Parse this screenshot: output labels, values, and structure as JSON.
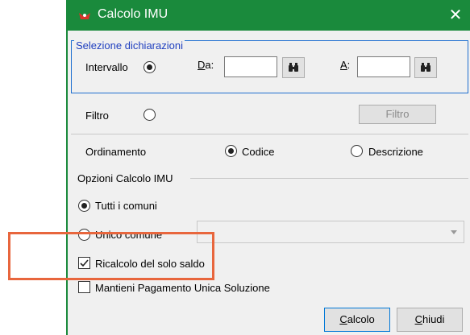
{
  "window": {
    "title": "Calcolo IMU",
    "close_glyph": "✕",
    "title_bar_color": "#1a8a3c"
  },
  "selezione": {
    "legend": "Selezione dichiarazioni",
    "intervallo_label": "Intervallo",
    "intervallo_checked": true,
    "da_label": "Da:",
    "da_value": "",
    "a_label": "A:",
    "a_value": "",
    "search_icon": "binoculars-icon",
    "filtro_label": "Filtro",
    "filtro_checked": false,
    "filtro_button": "Filtro",
    "ordinamento_label": "Ordinamento",
    "codice_label": "Codice",
    "codice_checked": true,
    "descrizione_label": "Descrizione",
    "descrizione_checked": false
  },
  "opzioni": {
    "legend": "Opzioni Calcolo IMU",
    "tutti_label": "Tutti i comuni",
    "tutti_checked": true,
    "unico_label": "Unico comune",
    "unico_checked": false,
    "unico_value": "",
    "ricalcolo_label": "Ricalcolo del solo saldo",
    "ricalcolo_checked": true,
    "mantieni_label": "Mantieni Pagamento Unica Soluzione",
    "mantieni_checked": false
  },
  "buttons": {
    "calcolo": "Calcolo",
    "chiudi": "Chiudi"
  },
  "annotation": {
    "color": "#e8663d"
  }
}
